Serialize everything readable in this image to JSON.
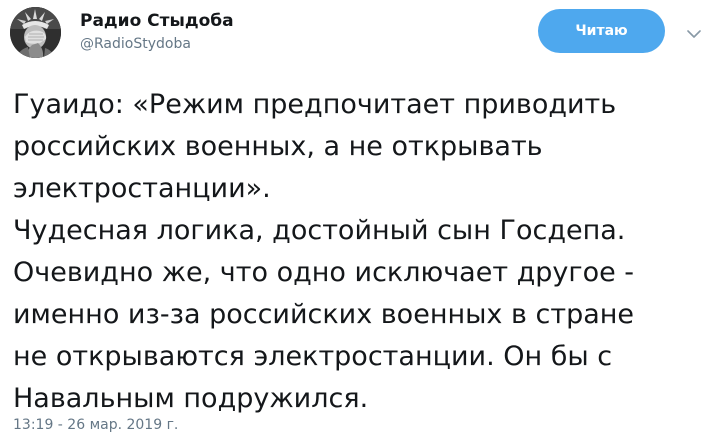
{
  "account": {
    "display_name": "Радио Стыдоба",
    "handle": "@RadioStydoba"
  },
  "follow_button": {
    "label": "Читаю"
  },
  "tweet": {
    "lines": [
      "Гуаидо: «Режим предпочитает приводить",
      "российских военных, а не открывать",
      "электростанции».",
      "Чудесная логика, достойный сын Госдепа.",
      "Очевидно же, что одно исключает другое -",
      "именно из-за российских военных в стране",
      "не открываются электростанции. Он бы с",
      "Навальным подружился."
    ],
    "timestamp": "13:19 - 26 мар. 2019 г."
  },
  "icons": {
    "avatar": "statue-of-liberty-facepalm-avatar",
    "menu": "chevron-down-icon"
  },
  "colors": {
    "follow_button_bg": "#4ea8ee",
    "text": "#14171a",
    "secondary_text": "#657786",
    "chevron": "#8899a6"
  }
}
